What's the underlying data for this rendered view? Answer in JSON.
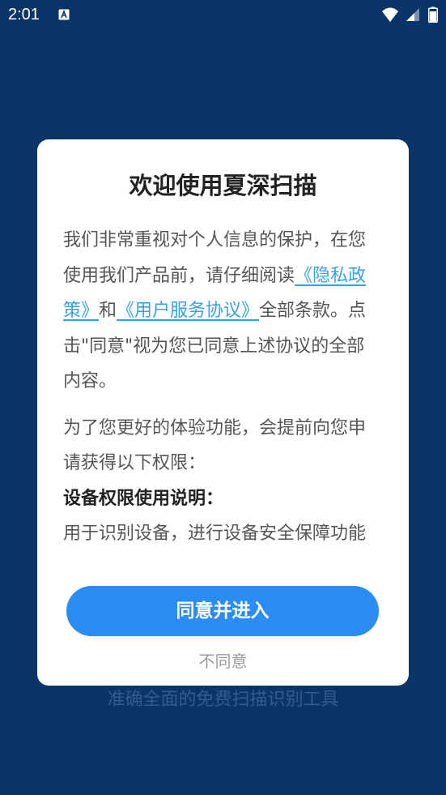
{
  "status_bar": {
    "time": "2:01"
  },
  "background": {
    "tagline": "准确全面的免费扫描识别工具"
  },
  "dialog": {
    "title": "欢迎使用夏深扫描",
    "intro_part1": "我们非常重视对个人信息的保护，在您使用我们产品前，请仔细阅读",
    "privacy_link": "《隐私政策》",
    "and_text": "和",
    "service_link": "《用户服务协议》",
    "intro_part2": "全部条款。点击\"同意\"视为您已同意上述协议的全部内容。",
    "permission_intro": "为了您更好的体验功能，会提前向您申请获得以下权限：",
    "permission_heading": "设备权限使用说明：",
    "permission_desc": "用于识别设备，进行设备安全保障功能",
    "agree_button": "同意并进入",
    "disagree_button": "不同意"
  },
  "colors": {
    "background": "#0b3566",
    "accent": "#2b8cf2",
    "link": "#3aa0e8"
  }
}
